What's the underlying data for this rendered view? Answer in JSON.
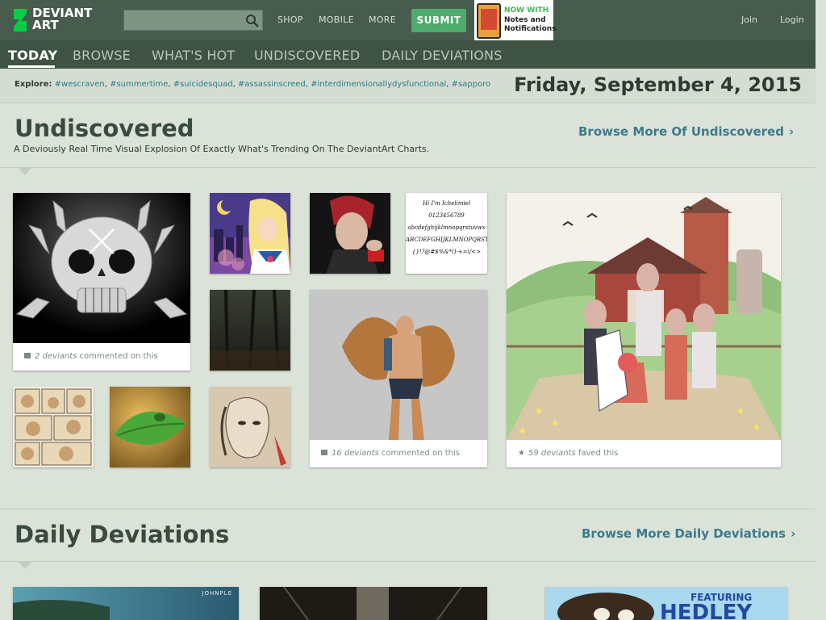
{
  "brand": {
    "line1": "DEVIANT",
    "line2": "ART"
  },
  "search": {
    "placeholder": "",
    "value": ""
  },
  "topnav": {
    "shop": "SHOP",
    "mobile": "MOBILE",
    "more": "MORE",
    "submit": "SUBMIT"
  },
  "promo": {
    "line1": "NOW WITH",
    "line2": "Notes and",
    "line3": "Notifications"
  },
  "auth": {
    "join": "Join",
    "login": "Login"
  },
  "tabs": [
    "TODAY",
    "BROWSE",
    "WHAT'S HOT",
    "UNDISCOVERED",
    "DAILY DEVIATIONS"
  ],
  "explore": {
    "label": "Explore:",
    "tags": [
      "#wescraven",
      "#summertime",
      "#suicidesquad",
      "#assassinscreed",
      "#interdimensionallydysfunctional",
      "#sapporo"
    ]
  },
  "date": "Friday, September 4, 2015",
  "undiscovered": {
    "title": "Undiscovered",
    "subtitle": "A Deviously Real Time Visual Explosion Of Exactly What's Trending On The DeviantArt Charts.",
    "browse_link": "Browse More Of Undiscovered",
    "cap1_count": "2 deviants",
    "cap1_text": "commented on this",
    "cap2_count": "16 deviants",
    "cap2_text": "commented on this",
    "cap3_count": "59 deviants",
    "cap3_text": "faved this"
  },
  "font_sample": {
    "line1": "Hi I'm Ichelimiel",
    "line2": "0123456789",
    "line3": "abcdefghijklmnopqrstuvwx",
    "line4": "ABCDEFGHIJKLMNOPQRSTUV",
    "line5": "{}!?@#$%&*()-+=\\/<>"
  },
  "daily": {
    "title": "Daily Deviations",
    "browse_link": "Browse More Daily Deviations",
    "dd1_watermark": "JOHNPLE",
    "dd3_text1": "FEATURING",
    "dd3_text2": "HEDLEY"
  },
  "colors": {
    "topbar": "#475c4d",
    "subnav": "#3e5343",
    "body": "#dbe2d8",
    "submit": "#4fab6c",
    "link": "#3c7a8c",
    "logo_green": "#05cc47"
  }
}
